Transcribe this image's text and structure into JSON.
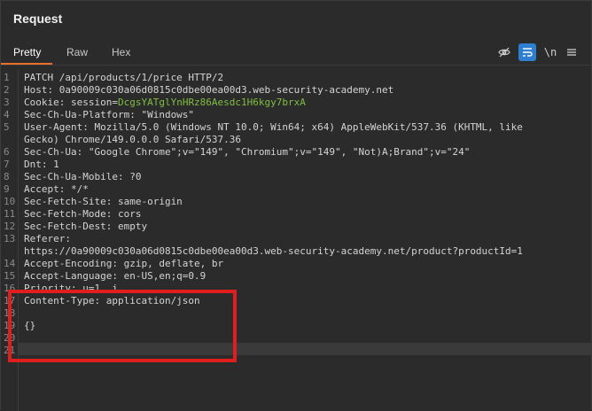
{
  "panel": {
    "title": "Request"
  },
  "tabs": [
    {
      "label": "Pretty",
      "active": true
    },
    {
      "label": "Raw",
      "active": false
    },
    {
      "label": "Hex",
      "active": false
    }
  ],
  "toolbar": {
    "hide_icon": "eye-slash-icon",
    "wrap_icon": "wrap-icon",
    "newline_label": "\\n",
    "menu_icon": "hamburger-icon"
  },
  "lines": [
    {
      "n": "1",
      "text": "PATCH /api/products/1/price HTTP/2"
    },
    {
      "n": "2",
      "text": "Host: 0a90009c030a06d0815c0dbe00ea00d3.web-security-academy.net"
    },
    {
      "n": "3",
      "pre": "Cookie: ",
      "name": "session=",
      "val": "DcgsYATglYnHRz86Aesdc1H6kgy7brxA"
    },
    {
      "n": "4",
      "text": "Sec-Ch-Ua-Platform: \"Windows\""
    },
    {
      "n": "5",
      "text": "User-Agent: Mozilla/5.0 (Windows NT 10.0; Win64; x64) AppleWebKit/537.36 (KHTML, like"
    },
    {
      "n": "",
      "text": "Gecko) Chrome/149.0.0.0 Safari/537.36"
    },
    {
      "n": "6",
      "text": "Sec-Ch-Ua: \"Google Chrome\";v=\"149\", \"Chromium\";v=\"149\", \"Not)A;Brand\";v=\"24\""
    },
    {
      "n": "7",
      "text": "Dnt: 1"
    },
    {
      "n": "8",
      "text": "Sec-Ch-Ua-Mobile: ?0"
    },
    {
      "n": "9",
      "text": "Accept: */*"
    },
    {
      "n": "10",
      "text": "Sec-Fetch-Site: same-origin"
    },
    {
      "n": "11",
      "text": "Sec-Fetch-Mode: cors"
    },
    {
      "n": "12",
      "text": "Sec-Fetch-Dest: empty"
    },
    {
      "n": "13",
      "text": "Referer:"
    },
    {
      "n": "",
      "text": "https://0a90009c030a06d0815c0dbe00ea00d3.web-security-academy.net/product?productId=1"
    },
    {
      "n": "14",
      "text": "Accept-Encoding: gzip, deflate, br"
    },
    {
      "n": "15",
      "text": "Accept-Language: en-US,en;q=0.9"
    },
    {
      "n": "16",
      "text": "Priority: u=1, i"
    },
    {
      "n": "17",
      "text": "Content-Type: application/json"
    },
    {
      "n": "18",
      "text": ""
    },
    {
      "n": "19",
      "text": "{}"
    },
    {
      "n": "20",
      "text": ""
    },
    {
      "n": "21",
      "text": ""
    }
  ]
}
